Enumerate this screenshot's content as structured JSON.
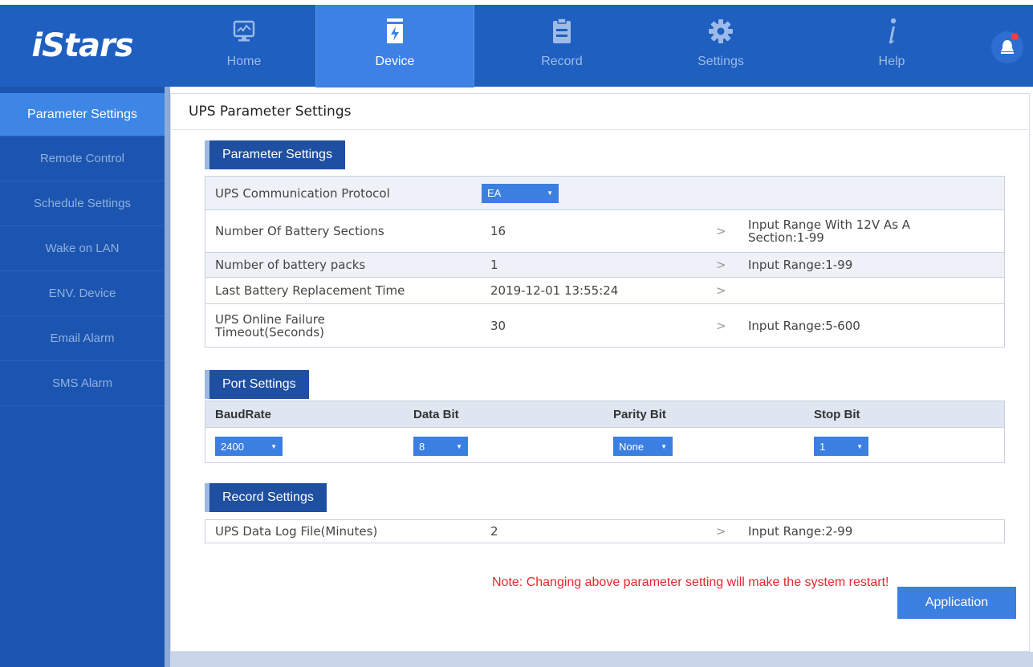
{
  "app": {
    "logo": "iStars"
  },
  "nav": {
    "items": [
      {
        "label": "Home",
        "icon": "monitor-icon"
      },
      {
        "label": "Device",
        "icon": "battery-icon"
      },
      {
        "label": "Record",
        "icon": "document-icon"
      },
      {
        "label": "Settings",
        "icon": "gear-icon"
      },
      {
        "label": "Help",
        "icon": "info-icon"
      }
    ],
    "active": "Device",
    "bell_icon": "bell-icon"
  },
  "sidebar": {
    "items": [
      {
        "label": "Parameter Settings"
      },
      {
        "label": "Remote Control"
      },
      {
        "label": "Schedule Settings"
      },
      {
        "label": "Wake on LAN"
      },
      {
        "label": "ENV. Device"
      },
      {
        "label": "Email Alarm"
      },
      {
        "label": "SMS Alarm"
      }
    ],
    "active": "Parameter Settings"
  },
  "main": {
    "title": "UPS Parameter Settings",
    "parameter_settings": {
      "heading": "Parameter Settings",
      "rows": [
        {
          "label": "UPS Communication Protocol",
          "value": "EA",
          "hint": ""
        },
        {
          "label": "Number Of Battery Sections",
          "value": "16",
          "hint": "Input Range With 12V As A Section:1-99"
        },
        {
          "label": "Number of battery packs",
          "value": "1",
          "hint": "Input Range:1-99"
        },
        {
          "label": "Last Battery Replacement Time",
          "value": "2019-12-01 13:55:24",
          "hint": ""
        },
        {
          "label": "UPS Online Failure Timeout(Seconds)",
          "value": "30",
          "hint": "Input Range:5-600"
        }
      ]
    },
    "port_settings": {
      "heading": "Port Settings",
      "columns": [
        "BaudRate",
        "Data Bit",
        "Parity Bit",
        "Stop Bit"
      ],
      "values": [
        "2400",
        "8",
        "None",
        "1"
      ]
    },
    "record_settings": {
      "heading": "Record Settings",
      "rows": [
        {
          "label": "UPS Data Log File(Minutes)",
          "value": "2",
          "hint": "Input Range:2-99"
        }
      ]
    },
    "note": "Note: Changing above parameter setting will make the system restart!",
    "apply_label": "Application"
  },
  "colors": {
    "topbar": "#1e5fbf",
    "active_nav": "#3c81e3",
    "sidebar": "#1c55b0",
    "accent": "#3b7fe0",
    "section_tab": "#1e4fa0",
    "note": "#e8262d"
  }
}
